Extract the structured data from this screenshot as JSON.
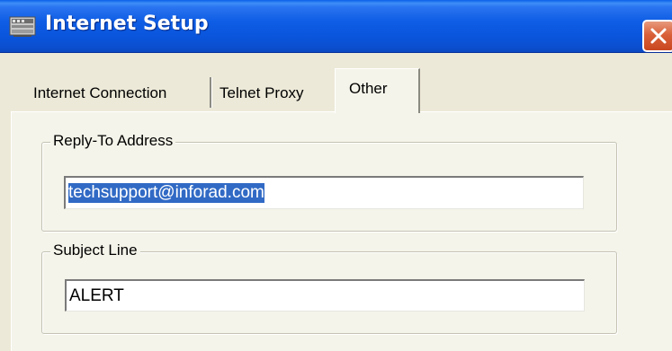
{
  "window": {
    "title": "Internet Setup",
    "title_icon": "network-setup-icon",
    "close_icon": "close-icon"
  },
  "tabs": [
    {
      "label": "Internet Connection",
      "selected": false
    },
    {
      "label": "Telnet Proxy",
      "selected": false
    },
    {
      "label": "Other",
      "selected": true
    }
  ],
  "reply_to": {
    "legend": "Reply-To Address",
    "value": "techsupport@inforad.com",
    "text_selected": true
  },
  "subject": {
    "legend": "Subject Line",
    "value": "ALERT"
  },
  "colors": {
    "titlebar": "#0a55dc",
    "panel": "#f5f4ea",
    "dialog": "#ece9d8",
    "selection": "#316ac5",
    "close_button": "#d9603a"
  }
}
